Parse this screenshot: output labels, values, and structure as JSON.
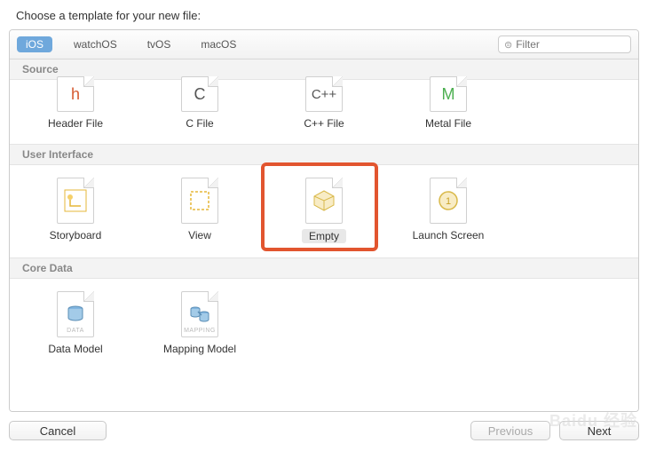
{
  "title": "Choose a template for your new file:",
  "platforms": [
    "iOS",
    "watchOS",
    "tvOS",
    "macOS"
  ],
  "active_platform": "iOS",
  "filter_placeholder": "Filter",
  "sections": [
    {
      "name": "Source",
      "items": [
        {
          "label": "Header File",
          "icon": "h"
        },
        {
          "label": "C File",
          "icon": "c"
        },
        {
          "label": "C++ File",
          "icon": "cpp"
        },
        {
          "label": "Metal File",
          "icon": "metal"
        }
      ]
    },
    {
      "name": "User Interface",
      "items": [
        {
          "label": "Storyboard",
          "icon": "storyboard"
        },
        {
          "label": "View",
          "icon": "view"
        },
        {
          "label": "Empty",
          "icon": "empty",
          "selected": true,
          "highlighted": true
        },
        {
          "label": "Launch Screen",
          "icon": "launch"
        }
      ]
    },
    {
      "name": "Core Data",
      "items": [
        {
          "label": "Data Model",
          "icon": "data"
        },
        {
          "label": "Mapping Model",
          "icon": "mapping"
        }
      ]
    }
  ],
  "buttons": {
    "cancel": "Cancel",
    "previous": "Previous",
    "next": "Next"
  },
  "watermark": "Baidu 经验"
}
